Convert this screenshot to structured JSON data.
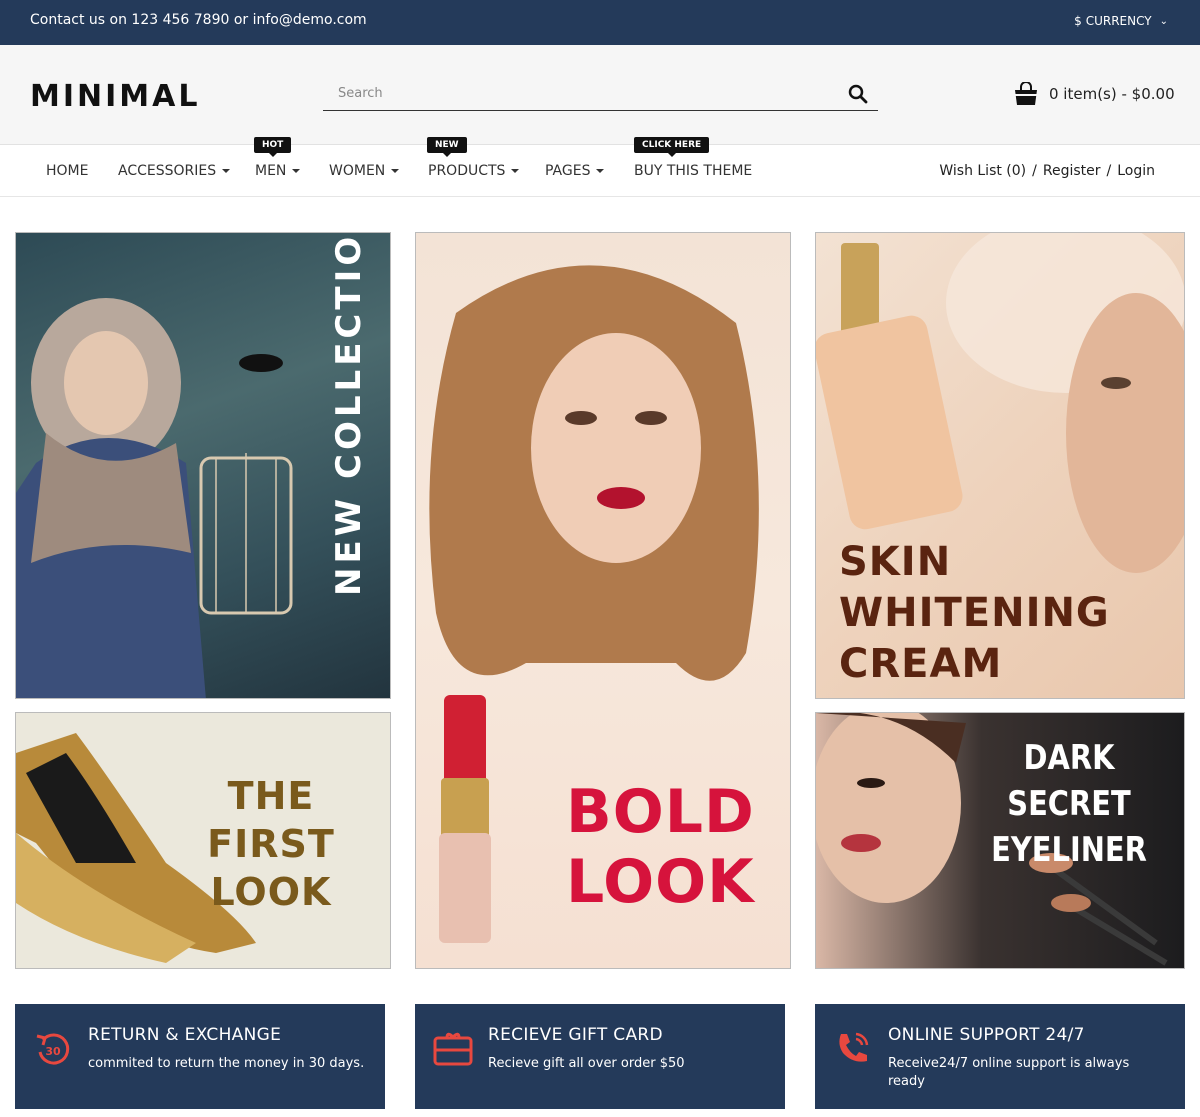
{
  "topbar": {
    "contact": "Contact us on 123 456 7890 or info@demo.com",
    "currency_symbol": "$",
    "currency_label": "CURRENCY"
  },
  "header": {
    "logo": "MINIMAL",
    "search_placeholder": "Search",
    "cart_text": "0 item(s) - $0.00"
  },
  "nav": {
    "items": [
      {
        "label": "HOME"
      },
      {
        "label": "ACCESSORIES"
      },
      {
        "label": "MEN",
        "badge": "HOT"
      },
      {
        "label": "WOMEN"
      },
      {
        "label": "PRODUCTS",
        "badge": "NEW"
      },
      {
        "label": "PAGES"
      },
      {
        "label": "BUY THIS THEME",
        "badge": "CLICK HERE"
      }
    ],
    "account": {
      "wishlist": "Wish List (0)",
      "register": "Register",
      "login": "Login",
      "separator": "/"
    }
  },
  "banners": {
    "new_collection": "NEW COLLECTION",
    "bold_look_1": "BOLD",
    "bold_look_2": "LOOK",
    "skin_1": "SKIN",
    "skin_2": "WHITENING",
    "skin_3": "CREAM",
    "first_look_1": "THE FIRST",
    "first_look_2": "LOOK",
    "dark_secret_1": "DARK SECRET",
    "dark_secret_2": "EYELINER"
  },
  "features": [
    {
      "title": "RETURN & EXCHANGE",
      "desc": "commited to return the money in 30 days.",
      "icon": "return-30-icon",
      "icon_text": "30"
    },
    {
      "title": "RECIEVE GIFT CARD",
      "desc": "Recieve gift all over order $50",
      "icon": "gift-card-icon"
    },
    {
      "title": "ONLINE SUPPORT 24/7",
      "desc": "Receive24/7 online support is always ready",
      "icon": "phone-support-icon"
    }
  ],
  "colors": {
    "navy": "#243a5a",
    "accent_red": "#e8483f",
    "bold_red": "#d6133c"
  }
}
